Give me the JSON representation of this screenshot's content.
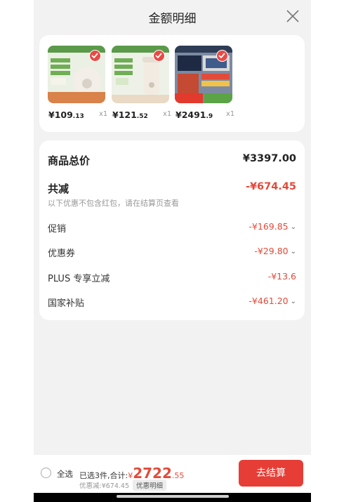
{
  "header": {
    "title": "金额明细",
    "close_icon": "close-icon"
  },
  "products": [
    {
      "price_int": "¥109",
      "price_dec": ".13",
      "qty": "x1",
      "colors": [
        "#e7f1df",
        "#e8e3dc"
      ]
    },
    {
      "price_int": "¥121",
      "price_dec": ".52",
      "qty": "x1",
      "colors": [
        "#e9f1e2",
        "#ece4da"
      ]
    },
    {
      "price_int": "¥2491",
      "price_dec": ".9",
      "qty": "x1",
      "colors": [
        "#3a4a66",
        "#d94c36"
      ]
    }
  ],
  "summary": {
    "total_label": "商品总价",
    "total_value": "¥3397.00",
    "discount_label": "共减",
    "discount_value": "-¥674.45",
    "note": "以下优惠不包含红包，请在结算页查看",
    "rows": [
      {
        "label": "促销",
        "value": "-¥169.85"
      },
      {
        "label": "优惠券",
        "value": "-¥29.80"
      },
      {
        "label": "PLUS 专享立减",
        "value": "-¥13.6"
      },
      {
        "label": "国家补贴",
        "value": "-¥461.20"
      }
    ]
  },
  "footer": {
    "select_all": "全选",
    "selected_text": "已选3件,合计:",
    "currency": "¥",
    "total_int": "2722",
    "total_dec": ".55",
    "discount_text": "优惠减:¥674.45",
    "detail_button": "优惠明细",
    "checkout_button": "去结算"
  },
  "colors": {
    "accent": "#e63e36",
    "price_red": "#e24b3b",
    "background": "#f2f2f2"
  }
}
